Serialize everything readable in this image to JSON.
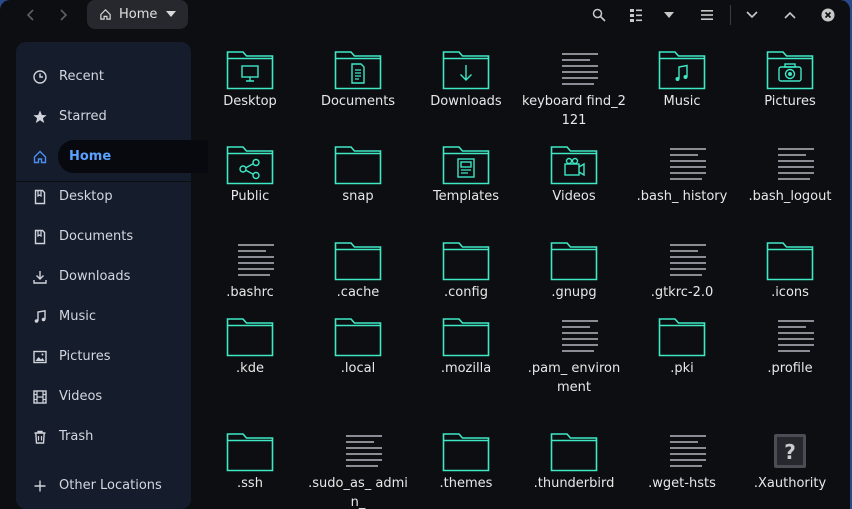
{
  "header": {
    "path_label": "Home",
    "colors": {
      "accent": "#5aa0ff",
      "folder": "#3ee8c5"
    }
  },
  "sidebar": {
    "items": [
      {
        "label": "Recent",
        "icon": "clock-icon",
        "name": "sidebar-item-recent"
      },
      {
        "label": "Starred",
        "icon": "star-icon",
        "name": "sidebar-item-starred"
      },
      {
        "label": "Home",
        "icon": "home-icon",
        "name": "sidebar-item-home",
        "active": true
      },
      {
        "label": "Desktop",
        "icon": "bookmark-icon",
        "name": "sidebar-item-desktop"
      },
      {
        "label": "Documents",
        "icon": "bookmark-icon",
        "name": "sidebar-item-documents"
      },
      {
        "label": "Downloads",
        "icon": "download-icon",
        "name": "sidebar-item-downloads"
      },
      {
        "label": "Music",
        "icon": "music-icon",
        "name": "sidebar-item-music"
      },
      {
        "label": "Pictures",
        "icon": "picture-icon",
        "name": "sidebar-item-pictures"
      },
      {
        "label": "Videos",
        "icon": "film-icon",
        "name": "sidebar-item-videos"
      },
      {
        "label": "Trash",
        "icon": "trash-icon",
        "name": "sidebar-item-trash"
      },
      {
        "label": "Other Locations",
        "icon": "plus-icon",
        "name": "sidebar-item-other-locations"
      }
    ]
  },
  "files": [
    {
      "name": "Desktop",
      "type": "folder",
      "emblem": "desktop"
    },
    {
      "name": "Documents",
      "type": "folder",
      "emblem": "document"
    },
    {
      "name": "Downloads",
      "type": "folder",
      "emblem": "download"
    },
    {
      "name": "keyboard find_2121",
      "type": "text"
    },
    {
      "name": "Music",
      "type": "folder",
      "emblem": "music"
    },
    {
      "name": "Pictures",
      "type": "folder",
      "emblem": "camera"
    },
    {
      "name": "Public",
      "type": "folder",
      "emblem": "share"
    },
    {
      "name": "snap",
      "type": "folder"
    },
    {
      "name": "Templates",
      "type": "folder",
      "emblem": "template"
    },
    {
      "name": "Videos",
      "type": "folder",
      "emblem": "video"
    },
    {
      "name": ".bash_ history",
      "type": "text"
    },
    {
      "name": ".bash_logout",
      "type": "text"
    },
    {
      "name": ".bashrc",
      "type": "text"
    },
    {
      "name": ".cache",
      "type": "folder"
    },
    {
      "name": ".config",
      "type": "folder"
    },
    {
      "name": ".gnupg",
      "type": "folder"
    },
    {
      "name": ".gtkrc-2.0",
      "type": "text"
    },
    {
      "name": ".icons",
      "type": "folder"
    },
    {
      "name": ".kde",
      "type": "folder"
    },
    {
      "name": ".local",
      "type": "folder"
    },
    {
      "name": ".mozilla",
      "type": "folder"
    },
    {
      "name": ".pam_ environment",
      "type": "text"
    },
    {
      "name": ".pki",
      "type": "folder"
    },
    {
      "name": ".profile",
      "type": "text"
    },
    {
      "name": ".ssh",
      "type": "folder"
    },
    {
      "name": ".sudo_as_ admin_",
      "type": "text"
    },
    {
      "name": ".themes",
      "type": "folder"
    },
    {
      "name": ".thunderbird",
      "type": "folder"
    },
    {
      "name": ".wget-hsts",
      "type": "text"
    },
    {
      "name": ".Xauthority",
      "type": "unknown"
    }
  ]
}
